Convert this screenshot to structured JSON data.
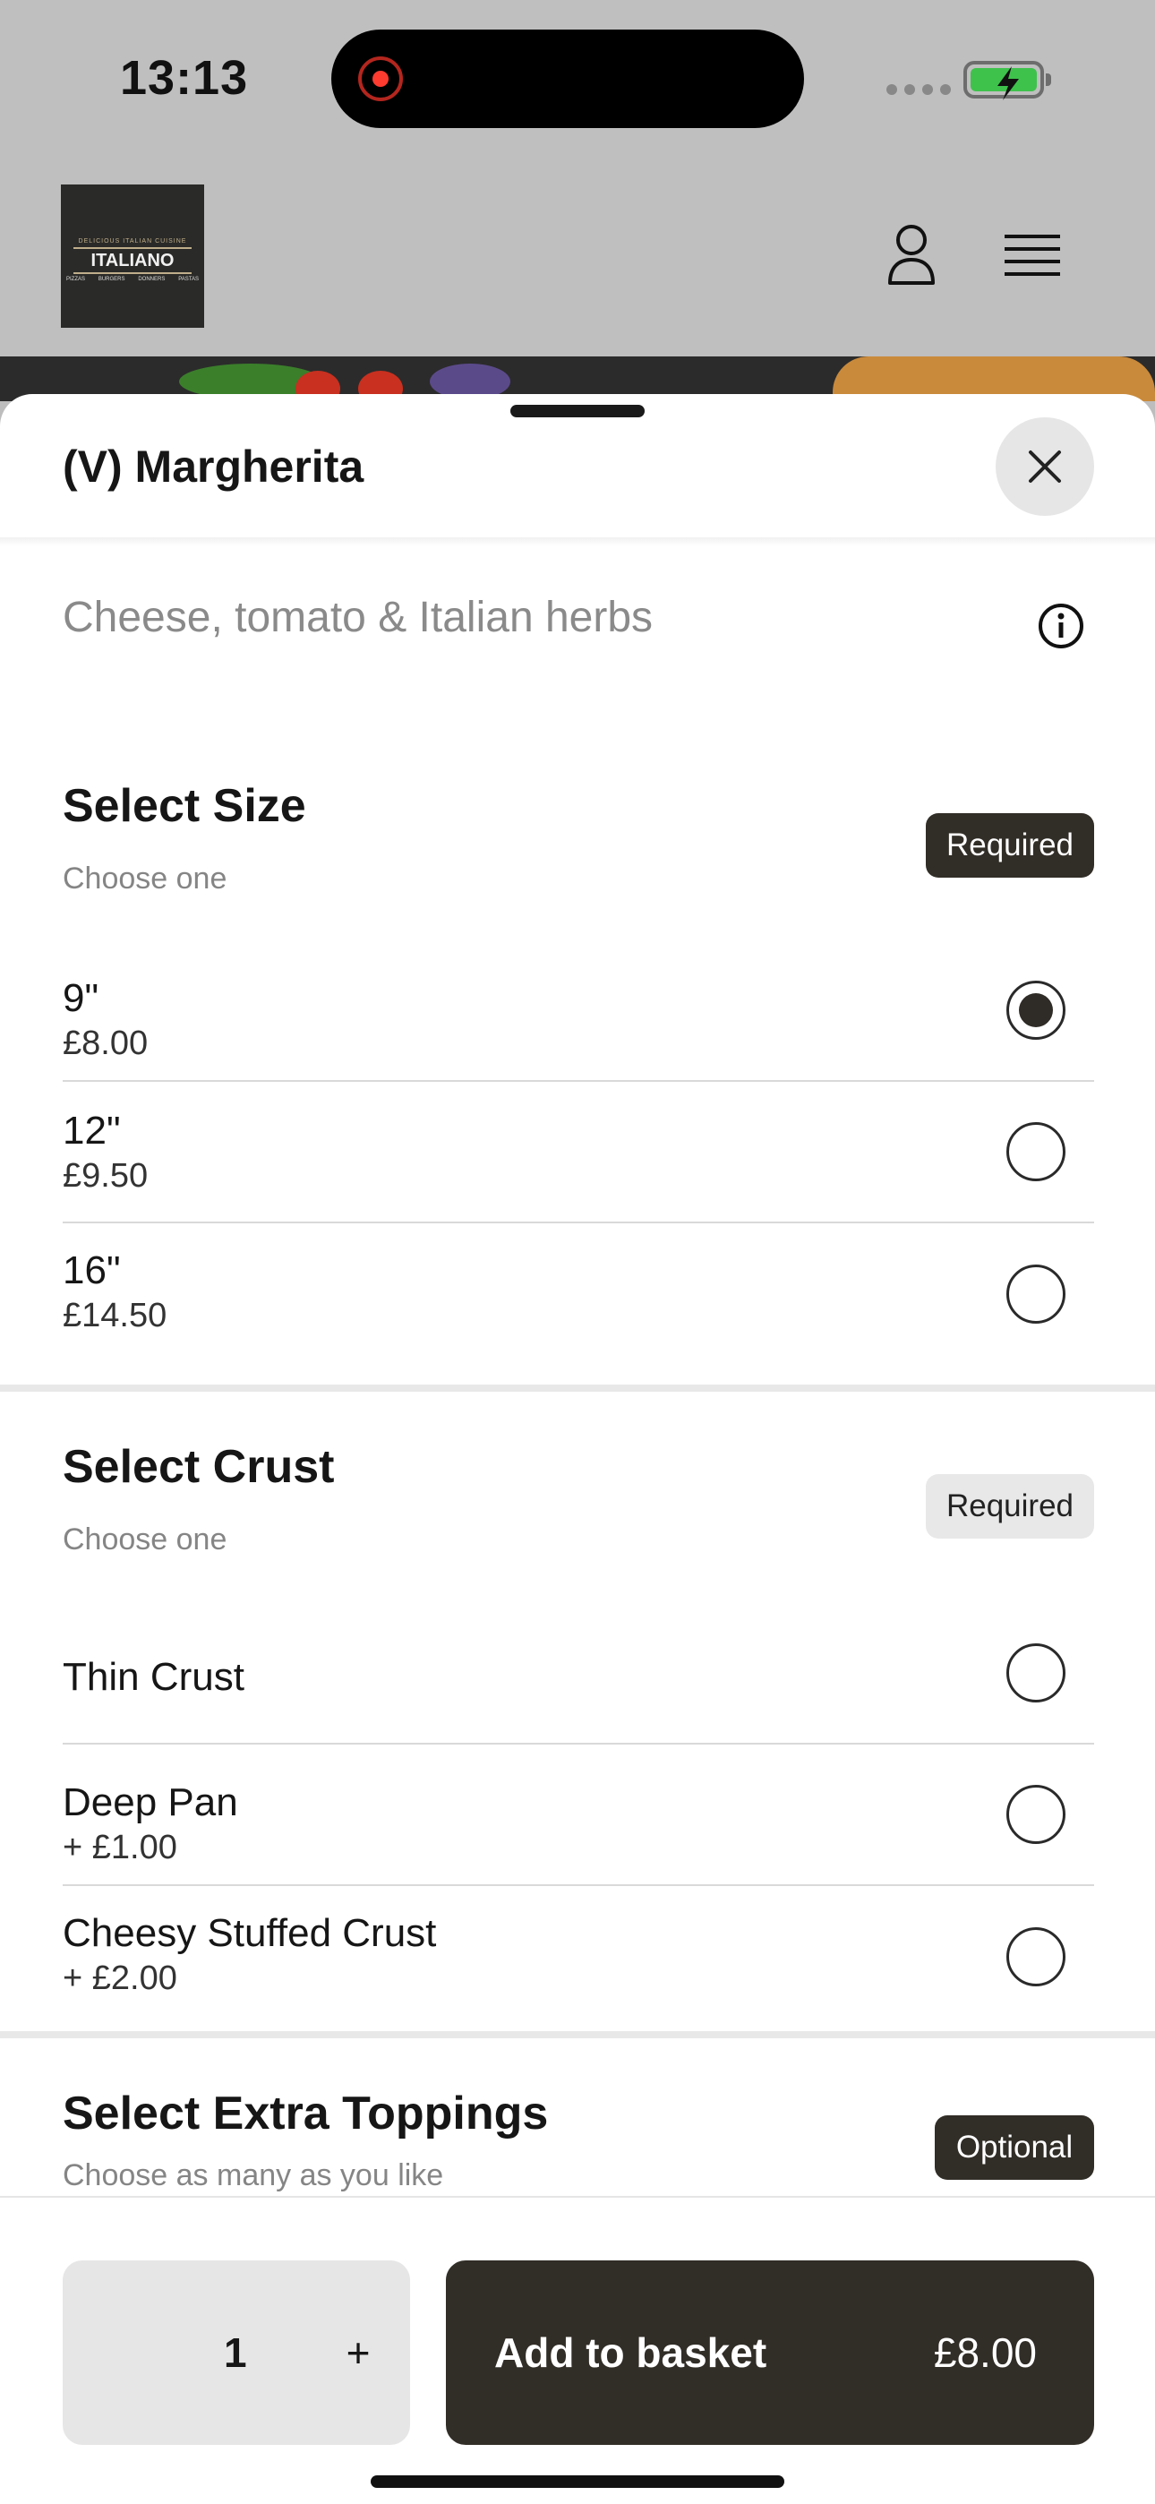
{
  "status_bar": {
    "time": "13:13"
  },
  "header": {
    "logo": {
      "tagline": "DELICIOUS ITALIAN CUISINE",
      "name": "ITALIANO",
      "categories": [
        "PIZZAS",
        "BURGERS",
        "DONNERS",
        "PASTAS"
      ]
    }
  },
  "item": {
    "title": "(V) Margherita",
    "description": "Cheese, tomato & Italian herbs"
  },
  "sections": {
    "size": {
      "title": "Select Size",
      "subtitle": "Choose one",
      "badge": "Required",
      "options": [
        {
          "name": "9\"",
          "price": "£8.00",
          "selected": true
        },
        {
          "name": "12\"",
          "price": "£9.50",
          "selected": false
        },
        {
          "name": "16\"",
          "price": "£14.50",
          "selected": false
        }
      ]
    },
    "crust": {
      "title": "Select Crust",
      "subtitle": "Choose one",
      "badge": "Required",
      "options": [
        {
          "name": "Thin Crust",
          "price": "",
          "selected": false
        },
        {
          "name": "Deep Pan",
          "price": "+ £1.00",
          "selected": false
        },
        {
          "name": "Cheesy Stuffed Crust",
          "price": "+ £2.00",
          "selected": false
        }
      ]
    },
    "toppings": {
      "title": "Select Extra Toppings",
      "subtitle": "Choose as many as you like",
      "badge": "Optional"
    }
  },
  "bottom_bar": {
    "quantity": "1",
    "plus": "+",
    "add_label": "Add to basket",
    "add_price": "£8.00"
  },
  "colors": {
    "accent_dark": "#312d27",
    "battery_green": "#3ec24c"
  }
}
